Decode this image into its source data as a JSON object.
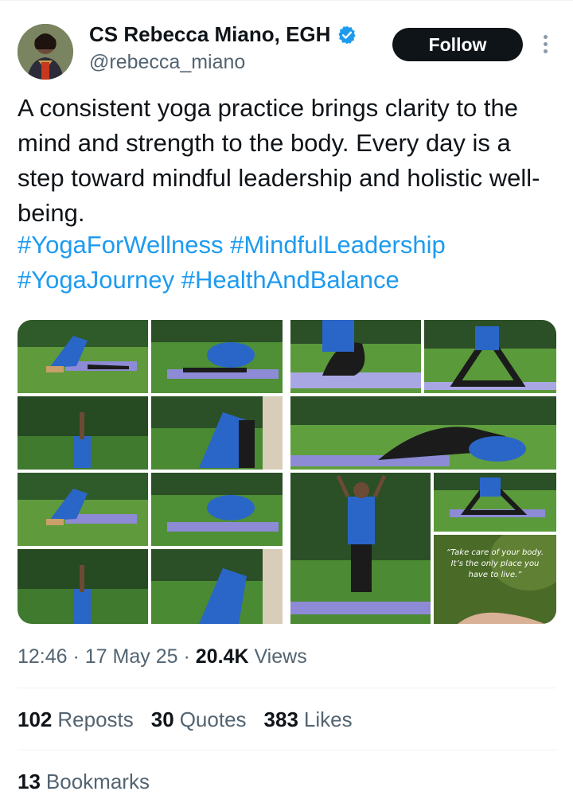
{
  "author": {
    "name": "CS Rebecca Miano, EGH",
    "handle": "@rebecca_miano",
    "verified": true,
    "verified_color": "#1d9bf0"
  },
  "follow_label": "Follow",
  "tweet": {
    "text": "A consistent yoga practice brings clarity to the mind and strength to the body. Every day is a step toward mindful leadership and holistic well-being.",
    "hashtags_line1": [
      "#YogaForWellness",
      "#MindfulLeadership"
    ],
    "hashtags_line2": [
      "#YogaJourney",
      "#HealthAndBalance"
    ],
    "hashtag_color": "#1d9bf0"
  },
  "media": {
    "quote_card": "“Take care of your body. It’s the only place you have to live.”"
  },
  "meta": {
    "time": "12:46",
    "date": "17 May 25",
    "views_count": "20.4K",
    "views_label": "Views"
  },
  "stats": {
    "reposts_count": "102",
    "reposts_label": "Reposts",
    "quotes_count": "30",
    "quotes_label": "Quotes",
    "likes_count": "383",
    "likes_label": "Likes",
    "bookmarks_count": "13",
    "bookmarks_label": "Bookmarks"
  }
}
